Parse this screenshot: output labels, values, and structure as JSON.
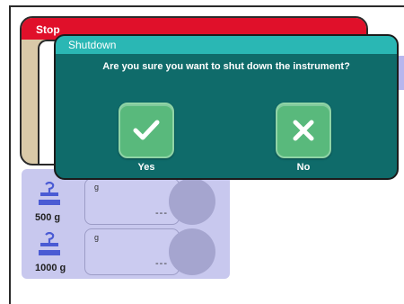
{
  "stop_dialog": {
    "title": "Stop"
  },
  "shutdown_dialog": {
    "title": "Shutdown",
    "question": "Are you sure you want to shut down the instrument?",
    "yes_label": "Yes",
    "no_label": "No",
    "yes_icon": "checkmark-icon",
    "no_icon": "cross-icon"
  },
  "scales": [
    {
      "weight": "500 g",
      "unit": "g",
      "value": "---",
      "icon": "weight-icon"
    },
    {
      "weight": "1000 g",
      "unit": "g",
      "value": "---",
      "icon": "weight-icon"
    }
  ],
  "colors": {
    "stop_header": "#e0102a",
    "dialog_bg": "#0f6b6a",
    "dialog_header": "#2ab7b4",
    "button_green": "#59b97c",
    "scale_panel": "#c8c8ee"
  }
}
